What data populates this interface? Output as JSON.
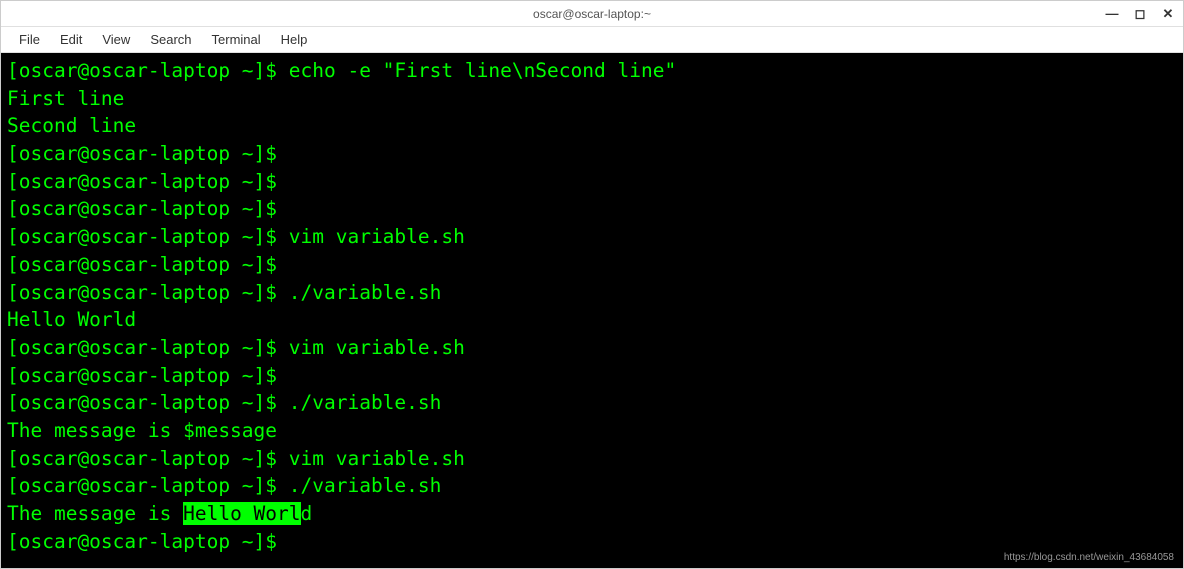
{
  "window": {
    "title": "oscar@oscar-laptop:~",
    "controls": {
      "minimize": "—",
      "maximize": "◻",
      "close": "✕"
    }
  },
  "menubar": {
    "items": [
      "File",
      "Edit",
      "View",
      "Search",
      "Terminal",
      "Help"
    ]
  },
  "terminal": {
    "prompt": "[oscar@oscar-laptop ~]$ ",
    "lines": [
      {
        "type": "cmd",
        "text": "echo -e \"First line\\nSecond line\""
      },
      {
        "type": "out",
        "text": "First line"
      },
      {
        "type": "out",
        "text": "Second line"
      },
      {
        "type": "cmd",
        "text": ""
      },
      {
        "type": "cmd",
        "text": ""
      },
      {
        "type": "cmd",
        "text": ""
      },
      {
        "type": "cmd",
        "text": "vim variable.sh"
      },
      {
        "type": "cmd",
        "text": ""
      },
      {
        "type": "cmd",
        "text": "./variable.sh"
      },
      {
        "type": "out",
        "text": "Hello World"
      },
      {
        "type": "cmd",
        "text": "vim variable.sh"
      },
      {
        "type": "cmd",
        "text": ""
      },
      {
        "type": "cmd",
        "text": "./variable.sh"
      },
      {
        "type": "out",
        "text": "The message is $message"
      },
      {
        "type": "cmd",
        "text": "vim variable.sh"
      },
      {
        "type": "cmd",
        "text": "./variable.sh"
      },
      {
        "type": "out-hl",
        "prefix": "The message is ",
        "highlight": "Hello Worl",
        "suffix": "d"
      },
      {
        "type": "cmd",
        "text": ""
      }
    ]
  },
  "watermark": "https://blog.csdn.net/weixin_43684058"
}
